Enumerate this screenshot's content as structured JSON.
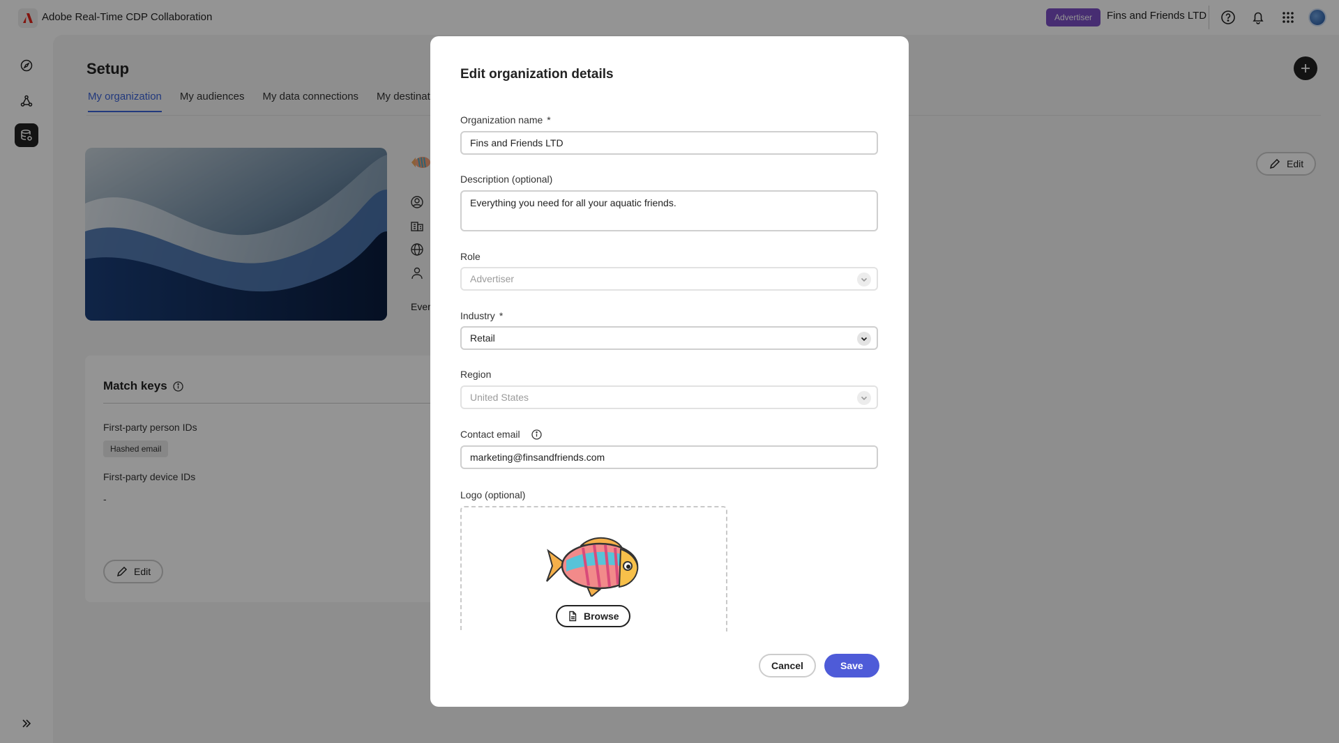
{
  "app": {
    "title": "Adobe Real-Time CDP Collaboration",
    "role_badge": "Advertiser",
    "org_name": "Fins and Friends LTD",
    "accent_color": "#3b63d8",
    "badge_color": "#7a4fc4"
  },
  "topbar_icons": [
    "help-icon",
    "bell-icon",
    "apps-grid-icon",
    "avatar"
  ],
  "leftnav": {
    "items": [
      "compass-icon",
      "graph-icon",
      "data-settings-icon"
    ],
    "bottom": "double-chevron-icon"
  },
  "page": {
    "title": "Setup",
    "tabs": [
      {
        "label": "My organization",
        "active": true
      },
      {
        "label": "My audiences",
        "active": false
      },
      {
        "label": "My data connections",
        "active": false
      },
      {
        "label": "My destinations",
        "active": false
      }
    ],
    "edit_label": "Edit",
    "description_partial": "Ever"
  },
  "match_keys": {
    "title": "Match keys",
    "person_ids_label": "First-party person IDs",
    "person_chip": "Hashed email",
    "device_ids_label": "First-party device IDs",
    "device_value": "-",
    "edit_label": "Edit"
  },
  "modal": {
    "title": "Edit organization details",
    "org_name_label": "Organization name",
    "org_name_value": "Fins and Friends LTD",
    "required_mark": "*",
    "description_label": "Description (optional)",
    "description_value": "Everything you need for all your aquatic friends.",
    "role_label": "Role",
    "role_value": "Advertiser",
    "industry_label": "Industry",
    "industry_value": "Retail",
    "region_label": "Region",
    "region_value": "United States",
    "contact_label": "Contact email",
    "contact_value": "marketing@finsandfriends.com",
    "logo_label": "Logo (optional)",
    "browse_label": "Browse",
    "cancel_label": "Cancel",
    "save_label": "Save",
    "save_color": "#4e5bd8"
  }
}
